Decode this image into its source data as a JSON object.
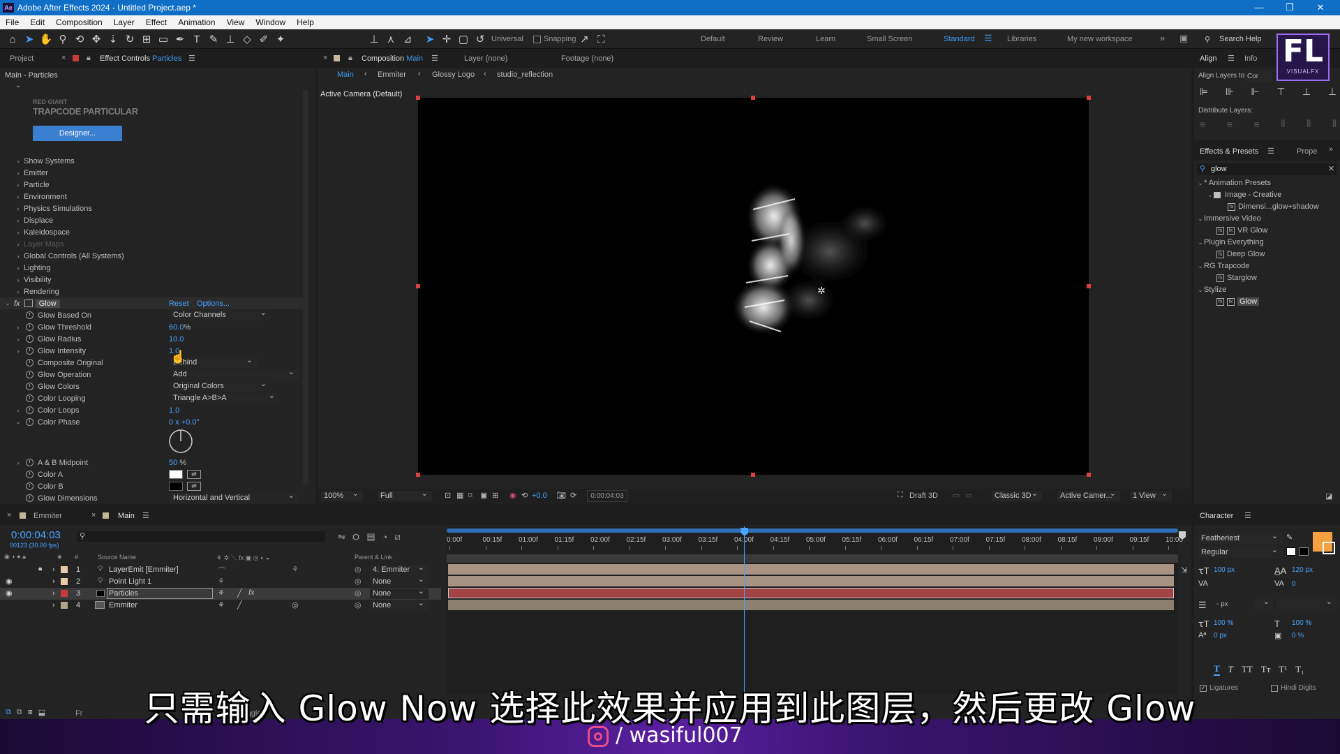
{
  "app": {
    "title": "Adobe After Effects 2024 - Untitled Project.aep *",
    "logo": "Ae"
  },
  "menu": [
    "File",
    "Edit",
    "Composition",
    "Layer",
    "Effect",
    "Animation",
    "View",
    "Window",
    "Help"
  ],
  "toolbar": {
    "universal_label": "Universal",
    "snapping_label": "Snapping",
    "workspaces": [
      "Default",
      "Review",
      "Learn",
      "Small Screen",
      "Standard",
      "Libraries",
      "My new workspace"
    ],
    "active_workspace": "Standard",
    "search_help": "Search Help"
  },
  "left_panel": {
    "tabs": [
      "Project",
      "Effect Controls"
    ],
    "effect_controls_layer": "Particles",
    "breadcrumb": "Main - Particles",
    "plugin_brand": "RED GIANT",
    "plugin_name": "TRAPCODE PARTICULAR",
    "designer_button": "Designer...",
    "groups": [
      "Show Systems",
      "Emitter",
      "Particle",
      "Environment",
      "Physics Simulations",
      "Displace",
      "Kaleidospace",
      "Layer Maps",
      "Global Controls (All Systems)",
      "Lighting",
      "Visibility",
      "Rendering"
    ],
    "glow": {
      "name": "Glow",
      "reset": "Reset",
      "options": "Options...",
      "props": [
        {
          "label": "Glow Based On",
          "value": "Color Channels",
          "kind": "dropdown"
        },
        {
          "label": "Glow Threshold",
          "value": "60.0",
          "unit": "%",
          "kind": "number"
        },
        {
          "label": "Glow Radius",
          "value": "10.0",
          "kind": "number"
        },
        {
          "label": "Glow Intensity",
          "value": "1.0",
          "kind": "number"
        },
        {
          "label": "Composite Original",
          "value": "Behind",
          "kind": "dropdown"
        },
        {
          "label": "Glow Operation",
          "value": "Add",
          "kind": "dropdown"
        },
        {
          "label": "Glow Colors",
          "value": "Original Colors",
          "kind": "dropdown"
        },
        {
          "label": "Color Looping",
          "value": "Triangle A>B>A",
          "kind": "dropdown"
        },
        {
          "label": "Color Loops",
          "value": "1.0",
          "kind": "number"
        },
        {
          "label": "Color Phase",
          "value": "0 x +0.0°",
          "kind": "number"
        },
        {
          "label": "A & B Midpoint",
          "value": "50",
          "unit": "%",
          "kind": "number"
        },
        {
          "label": "Color A",
          "value": "",
          "kind": "color",
          "color": "#ffffff"
        },
        {
          "label": "Color B",
          "value": "",
          "kind": "color",
          "color": "#000000"
        },
        {
          "label": "Glow Dimensions",
          "value": "Horizontal and Vertical",
          "kind": "dropdown"
        }
      ]
    }
  },
  "composition": {
    "tab_label": "Composition",
    "comp_name": "Main",
    "layer_tab": "Layer  (none)",
    "footage_tab": "Footage  (none)",
    "breadcrumbs": [
      "Main",
      "Emmiter",
      "Glossy Logo",
      "studio_reflection"
    ],
    "camera_label": "Active Camera (Default)",
    "footer": {
      "zoom": "100%",
      "resolution": "Full",
      "exposure": "+0.0",
      "timecode": "0:00:04:03",
      "draft": "Draft 3D",
      "renderer": "Classic 3D",
      "camera": "Active Camer...",
      "views": "1 View"
    }
  },
  "right_panel": {
    "align_tabs": [
      "Align",
      "Info"
    ],
    "align_layers_to": "Align Layers to:",
    "align_target": "Cor",
    "distribute_layers": "Distribute Layers:",
    "effects_tabs": [
      "Effects & Presets",
      "Prope"
    ],
    "search_value": "glow",
    "tree": [
      {
        "label": "* Animation Presets",
        "level": 0,
        "type": "group"
      },
      {
        "label": "Image - Creative",
        "level": 1,
        "type": "folder"
      },
      {
        "label": "Dimensi...glow+shadow",
        "level": 2,
        "type": "effect"
      },
      {
        "label": "Immersive Video",
        "level": 0,
        "type": "group"
      },
      {
        "label": "VR Glow",
        "level": 1,
        "type": "effect"
      },
      {
        "label": "Plugin Everything",
        "level": 0,
        "type": "group"
      },
      {
        "label": "Deep Glow",
        "level": 1,
        "type": "effect"
      },
      {
        "label": "RG Trapcode",
        "level": 0,
        "type": "group"
      },
      {
        "label": "Starglow",
        "level": 1,
        "type": "effect"
      },
      {
        "label": "Stylize",
        "level": 0,
        "type": "group"
      },
      {
        "label": "Glow",
        "level": 1,
        "type": "effect",
        "selected": true
      }
    ],
    "character": {
      "title": "Character",
      "font": "Featheriest",
      "style": "Regular",
      "size": "100 px",
      "leading": "120 px",
      "kerning": "",
      "tracking": "0",
      "stroke": "- px",
      "vscale": "100 %",
      "hscale": "100 %",
      "baseline": "0 px",
      "tsume": "0 %",
      "fill_color": "#f5a142",
      "ligatures": "Ligatures",
      "hindi": "Hindi Digits"
    }
  },
  "timeline": {
    "tabs": [
      "Emmiter",
      "Main"
    ],
    "active_tab": "Main",
    "timecode": "0:00:04:03",
    "frames": "00123 (30.00 fps)",
    "columns": {
      "source_name": "Source Name",
      "parent": "Parent & Link"
    },
    "ticks": [
      "0:00f",
      "00:15f",
      "01:00f",
      "01:15f",
      "02:00f",
      "02:15f",
      "03:00f",
      "03:15f",
      "04:00f",
      "04:15f",
      "05:00f",
      "05:15f",
      "06:00f",
      "06:15f",
      "07:00f",
      "07:15f",
      "08:00f",
      "08:15f",
      "09:00f",
      "09:15f",
      "10:00"
    ],
    "playhead_seconds": 4.1,
    "duration_seconds": 10,
    "layers": [
      {
        "num": "1",
        "name": "LayerEmit [Emmiter]",
        "parent": "4. Emmiter",
        "label_color": "#e8c9a8",
        "bar_color": "#a89383"
      },
      {
        "num": "2",
        "name": "Point Light 1",
        "parent": "None",
        "label_color": "#e8c9a8",
        "bar_color": "#a89383"
      },
      {
        "num": "3",
        "name": "Particles",
        "parent": "None",
        "label_color": "#c63a3a",
        "bar_color": "#a34343",
        "selected": true
      },
      {
        "num": "4",
        "name": "Emmiter",
        "parent": "None",
        "label_color": "#b0a58a",
        "bar_color": "#8c8171"
      }
    ],
    "footer_left": "Fr",
    "footer_toggle": "Toggle"
  },
  "overlay": {
    "subtitle": "只需输入 Glow Now 选择此效果并应用到此图层，然后更改 Glow",
    "handle": "/ wasiful007",
    "watermark_logo": "FL",
    "watermark_sub": "VISUALFX"
  }
}
